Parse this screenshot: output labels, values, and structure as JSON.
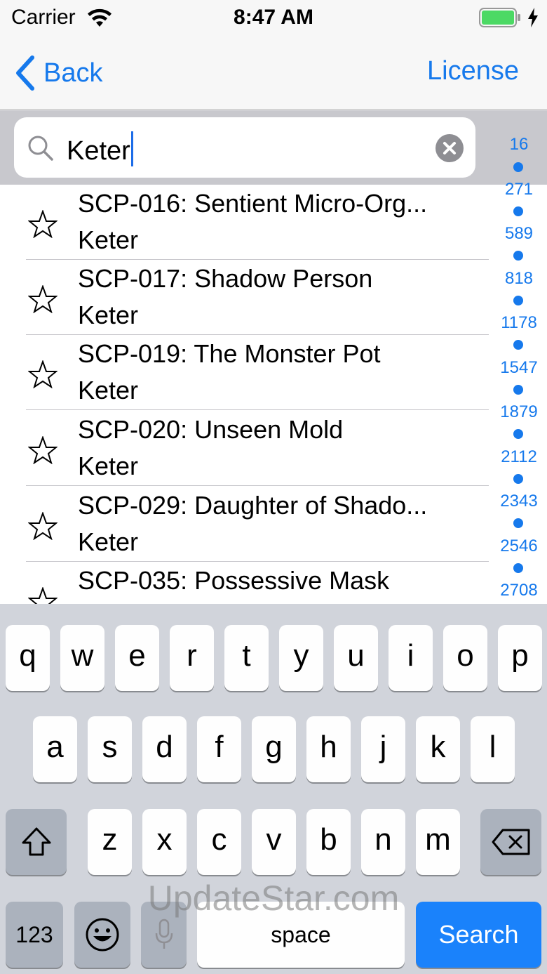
{
  "status_bar": {
    "carrier": "Carrier",
    "time": "8:47 AM"
  },
  "nav": {
    "back_label": "Back",
    "right_label": "License"
  },
  "search": {
    "value": "Keter"
  },
  "rows": [
    {
      "title": "SCP-016: Sentient Micro-Org...",
      "subtitle": "Keter"
    },
    {
      "title": "SCP-017: Shadow Person",
      "subtitle": "Keter"
    },
    {
      "title": "SCP-019: The Monster Pot",
      "subtitle": "Keter"
    },
    {
      "title": "SCP-020: Unseen Mold",
      "subtitle": "Keter"
    },
    {
      "title": "SCP-029: Daughter of Shado...",
      "subtitle": "Keter"
    },
    {
      "title": "SCP-035: Possessive Mask",
      "subtitle": ""
    }
  ],
  "index": [
    "16",
    "271",
    "589",
    "818",
    "1178",
    "1547",
    "1879",
    "2112",
    "2343",
    "2546",
    "2708"
  ],
  "keyboard": {
    "row1": [
      "q",
      "w",
      "e",
      "r",
      "t",
      "y",
      "u",
      "i",
      "o",
      "p"
    ],
    "row2": [
      "a",
      "s",
      "d",
      "f",
      "g",
      "h",
      "j",
      "k",
      "l"
    ],
    "row3": [
      "z",
      "x",
      "c",
      "v",
      "b",
      "n",
      "m"
    ],
    "numbers_label": "123",
    "space_label": "space",
    "search_label": "Search"
  },
  "watermark": "UpdateStar.com",
  "colors": {
    "accent": "#1679ec",
    "key_blue": "#1a82fb",
    "keyboard_bg": "#d1d4db"
  }
}
